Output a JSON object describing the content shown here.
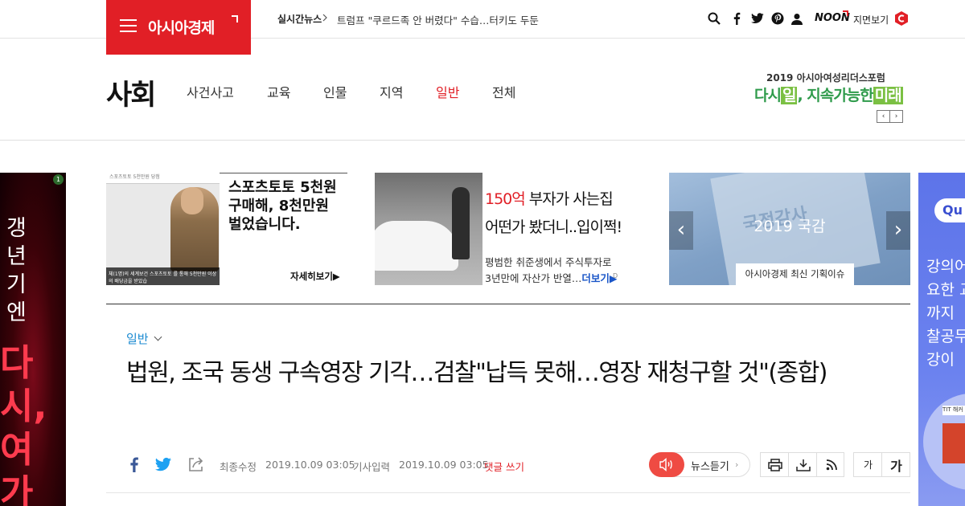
{
  "header": {
    "logo_text": "아시아경제",
    "ticker_label": "실시간뉴스",
    "ticker_text": "트럼프 \"쿠르드족 안 버렸다\" 수습…터키도 두둔",
    "noon_label": "NOON",
    "jimyeon_label": "지면보기",
    "icons": [
      "search-icon",
      "facebook-icon",
      "twitter-icon",
      "pinterest-icon",
      "user-icon"
    ]
  },
  "section": {
    "title": "사회",
    "nav": [
      {
        "label": "사건사고",
        "active": false
      },
      {
        "label": "교육",
        "active": false
      },
      {
        "label": "인물",
        "active": false
      },
      {
        "label": "지역",
        "active": false
      },
      {
        "label": "일반",
        "active": true
      },
      {
        "label": "전체",
        "active": false
      }
    ],
    "forum_line1": "2019 아시아여성리더스포럼",
    "forum_line2_pre": "다시",
    "forum_line2_hl1": "일",
    "forum_line2_mid": ", 지속가능한",
    "forum_line2_hl2": "미래",
    "forum_prev": "‹",
    "forum_next": "›"
  },
  "side_ads": {
    "left_text1": "갱년기엔",
    "left_text2": "다시,여가",
    "left_badge": "1",
    "right_q": "Qu",
    "right_lines": [
      "강의어",
      "요한 교",
      "까지 ",
      "찰공무",
      "강이 "
    ],
    "right_box_label": "TIT 해커"
  },
  "promos": {
    "p1_img_top": "스포츠토토 5천만원 당첨",
    "p1_img_caption": "체(1명)의 세계보건 스포츠토토 를 통해 5천만원 이상의 배당금을 받았습",
    "p1_title": "스포츠토토 5천원 구매해, 8천만원 벌었습니다.",
    "p1_more": "자세히보기▶",
    "p2_title_red": "150억",
    "p2_title_rest": " 부자가 사는집",
    "p2_title_line2": "어떤가 봤더니..입이쩍!",
    "p2_sub1": "평범한 취준생에서 주식투자로",
    "p2_sub2": "3년만에 자산가 반열…",
    "p2_more": "더보기▶",
    "p2_ad": "D",
    "banner_title": "2019 국감",
    "banner_doc_text": "국정감사",
    "banner_caption": "아시아경제 최신 기획이슈",
    "banner_prev": "‹",
    "banner_next": "›"
  },
  "article": {
    "category": "일반",
    "headline": "법원, 조국 동생 구속영장 기각…검찰\"납득 못해…영장 재청구할 것\"(종합)",
    "modified_label": "최종수정",
    "modified_time": "2019.10.09 03:05",
    "input_label": "기사입력",
    "input_time": "2019.10.09 03:05",
    "comment_label": "댓글 쓰기",
    "listen_label": "뉴스듣기",
    "listen_chev": "›",
    "font_small": "가",
    "font_large": "가"
  },
  "colors": {
    "brand_red": "#e11f26",
    "category_blue": "#1a8ad1",
    "forum_green": "#2f9b4b",
    "facebook_blue": "#3b5998",
    "twitter_blue": "#1da1f2"
  }
}
